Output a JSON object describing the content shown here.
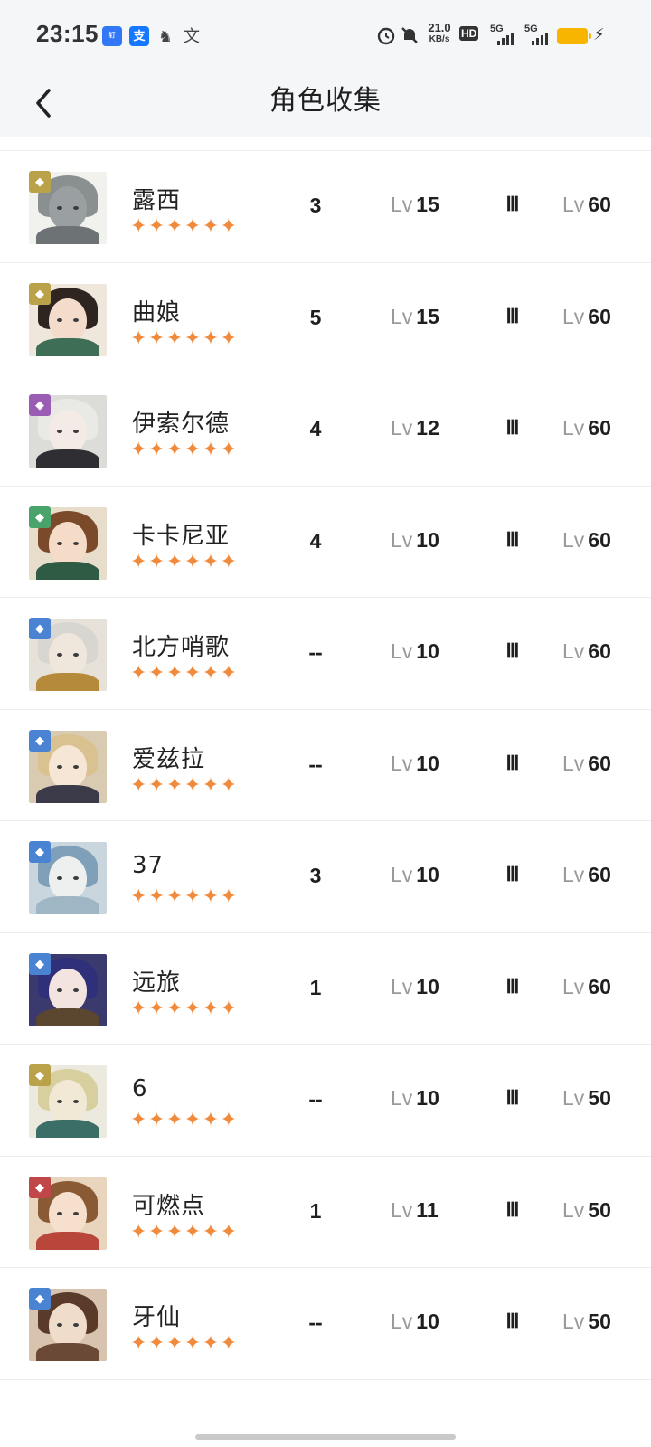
{
  "status_bar": {
    "time": "23:15",
    "app_icons": [
      "钉",
      "支",
      "♞",
      "文"
    ],
    "net_speed_value": "21.0",
    "net_speed_unit": "KB/s",
    "hd_label": "HD",
    "signal_labels": [
      "5G",
      "5G"
    ],
    "battery_color": "#f7b500"
  },
  "header": {
    "title": "角色收集",
    "back_icon": "chevron-left-icon"
  },
  "columns_note_hidden": "",
  "characters": [
    {
      "name": "露西",
      "stars": "✦✦✦✦✦✦",
      "count": "3",
      "lv_prefix": "Lv",
      "level": "15",
      "rank": "Ⅲ",
      "cap_prefix": "Lv",
      "cap": "60",
      "badge_icon": "triangle-icon",
      "badge_color": "#b9a24a",
      "hair": "#8a8f8f",
      "face": "#9aa0a2",
      "body": "#6d7375",
      "bg": "#f1f1ee"
    },
    {
      "name": "曲娘",
      "stars": "✦✦✦✦✦✦",
      "count": "5",
      "lv_prefix": "Lv",
      "level": "15",
      "rank": "Ⅲ",
      "cap_prefix": "Lv",
      "cap": "60",
      "badge_icon": "tower-icon",
      "badge_color": "#b9a24a",
      "hair": "#2e2420",
      "face": "#f3dccb",
      "body": "#3f6e56",
      "bg": "#efe6dc"
    },
    {
      "name": "伊索尔德",
      "stars": "✦✦✦✦✦✦",
      "count": "4",
      "lv_prefix": "Lv",
      "level": "12",
      "rank": "Ⅲ",
      "cap_prefix": "Lv",
      "cap": "60",
      "badge_icon": "moon-icon",
      "badge_color": "#9b5cb4",
      "hair": "#e9e9e6",
      "face": "#f4ebe6",
      "body": "#2f2f33",
      "bg": "#dcdcd9"
    },
    {
      "name": "卡卡尼亚",
      "stars": "✦✦✦✦✦✦",
      "count": "4",
      "lv_prefix": "Lv",
      "level": "10",
      "rank": "Ⅲ",
      "cap_prefix": "Lv",
      "cap": "60",
      "badge_icon": "leaf-icon",
      "badge_color": "#4aa36a",
      "hair": "#7a4a2a",
      "face": "#f4dcc8",
      "body": "#2f5a44",
      "bg": "#e8dccb"
    },
    {
      "name": "北方哨歌",
      "stars": "✦✦✦✦✦✦",
      "count": "--",
      "lv_prefix": "Lv",
      "level": "10",
      "rank": "Ⅲ",
      "cap_prefix": "Lv",
      "cap": "60",
      "badge_icon": "star-burst-icon",
      "badge_color": "#4b83d3",
      "hair": "#d8d6d0",
      "face": "#efe6dc",
      "body": "#b58a3a",
      "bg": "#e6e2da"
    },
    {
      "name": "爱兹拉",
      "stars": "✦✦✦✦✦✦",
      "count": "--",
      "lv_prefix": "Lv",
      "level": "10",
      "rank": "Ⅲ",
      "cap_prefix": "Lv",
      "cap": "60",
      "badge_icon": "star-burst-icon",
      "badge_color": "#4b83d3",
      "hair": "#d9c190",
      "face": "#f6e6d6",
      "body": "#3a3a48",
      "bg": "#d9cbb2"
    },
    {
      "name": "37",
      "stars": "✦✦✦✦✦✦",
      "count": "3",
      "lv_prefix": "Lv",
      "level": "10",
      "rank": "Ⅲ",
      "cap_prefix": "Lv",
      "cap": "60",
      "badge_icon": "star-burst-icon",
      "badge_color": "#4b83d3",
      "hair": "#7fa0b8",
      "face": "#eef0ef",
      "body": "#9fb7c4",
      "bg": "#c9d6de"
    },
    {
      "name": "远旅",
      "stars": "✦✦✦✦✦✦",
      "count": "1",
      "lv_prefix": "Lv",
      "level": "10",
      "rank": "Ⅲ",
      "cap_prefix": "Lv",
      "cap": "60",
      "badge_icon": "star-burst-icon",
      "badge_color": "#4b83d3",
      "hair": "#2f2f7a",
      "face": "#f3e4df",
      "body": "#5b4630",
      "bg": "#3a3a6e"
    },
    {
      "name": "6",
      "stars": "✦✦✦✦✦✦",
      "count": "--",
      "lv_prefix": "Lv",
      "level": "10",
      "rank": "Ⅲ",
      "cap_prefix": "Lv",
      "cap": "50",
      "badge_icon": "triangle-icon",
      "badge_color": "#b9a24a",
      "hair": "#d8cf9e",
      "face": "#f1e8d6",
      "body": "#3b6e66",
      "bg": "#eceadf"
    },
    {
      "name": "可燃点",
      "stars": "✦✦✦✦✦✦",
      "count": "1",
      "lv_prefix": "Lv",
      "level": "11",
      "rank": "Ⅲ",
      "cap_prefix": "Lv",
      "cap": "50",
      "badge_icon": "flame-icon",
      "badge_color": "#c0464a",
      "hair": "#8a5a34",
      "face": "#f6dfcc",
      "body": "#b8463a",
      "bg": "#e9d4bd"
    },
    {
      "name": "牙仙",
      "stars": "✦✦✦✦✦✦",
      "count": "--",
      "lv_prefix": "Lv",
      "level": "10",
      "rank": "Ⅲ",
      "cap_prefix": "Lv",
      "cap": "50",
      "badge_icon": "star-burst-icon",
      "badge_color": "#4b83d3",
      "hair": "#5a3a28",
      "face": "#f0dccb",
      "body": "#6a4a36",
      "bg": "#d8c3ae"
    }
  ]
}
